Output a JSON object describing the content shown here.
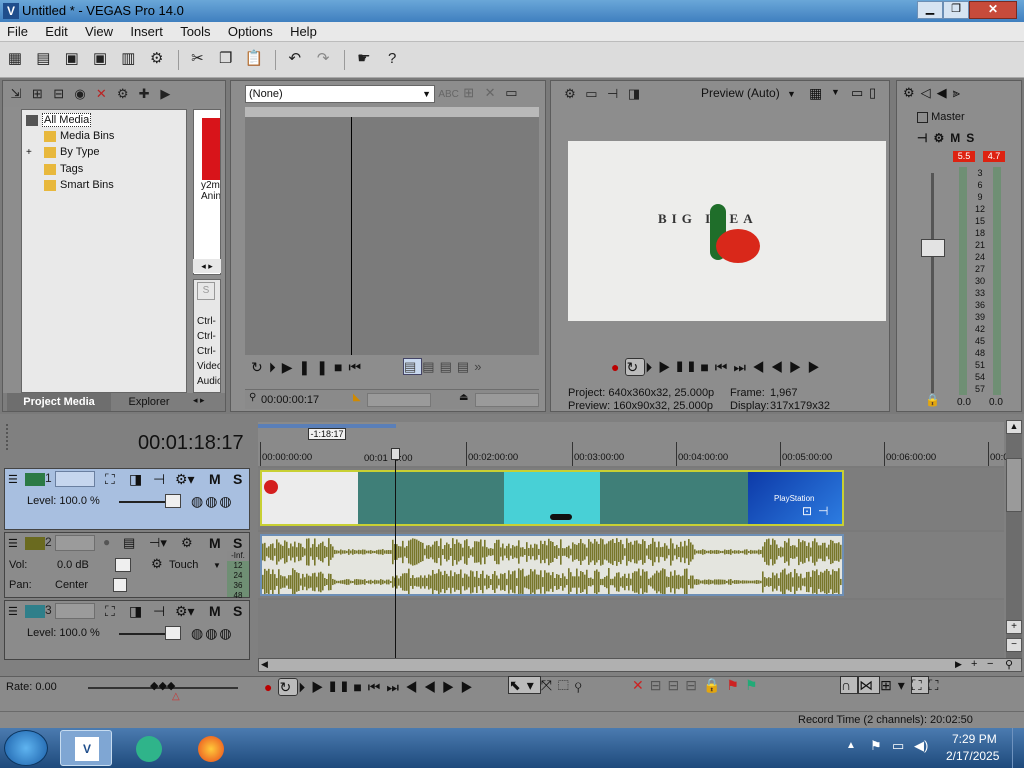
{
  "window": {
    "title": "Untitled * - VEGAS Pro 14.0",
    "app_icon": "vegas-v-icon"
  },
  "menu": [
    "File",
    "Edit",
    "View",
    "Insert",
    "Tools",
    "Options",
    "Help"
  ],
  "explorer": {
    "tree": [
      "All Media",
      "Media Bins",
      "By Type",
      "Tags",
      "Smart Bins"
    ],
    "tabs": [
      "Project Media",
      "Explorer"
    ],
    "media_caption_1": "y2m",
    "media_caption_2": "Anin",
    "side_lines": [
      "Ctrl-",
      "Ctrl-",
      "Ctrl-",
      "Video:",
      "Audio:"
    ]
  },
  "trimmer": {
    "dropdown": "(None)",
    "time": "00:00:00:17"
  },
  "preview": {
    "mode": "Preview (Auto)",
    "logo_text": "BIG IDEA",
    "project_label": "Project:",
    "project_value": "640x360x32, 25.000p",
    "preview_label": "Preview:",
    "preview_value": "160x90x32, 25.000p",
    "frame_label": "Frame:",
    "frame_value": "1,967",
    "display_label": "Display:",
    "display_value": "317x179x32"
  },
  "master": {
    "title": "Master",
    "peak_left": "5.5",
    "peak_right": "4.7",
    "scale": [
      "3",
      "6",
      "9",
      "12",
      "15",
      "18",
      "21",
      "24",
      "27",
      "30",
      "33",
      "36",
      "39",
      "42",
      "45",
      "48",
      "51",
      "54",
      "57"
    ],
    "val_left": "0.0",
    "val_right": "0.0"
  },
  "timeline": {
    "timecode": "00:01:18:17",
    "cursor_flag": "-1:18:17",
    "ruler": [
      "00:00:00:00",
      "00:01:00:00",
      "00:02:00:00",
      "00:03:00:00",
      "00:04:00:00",
      "00:05:00:00",
      "00:06:00:00",
      "00:0"
    ],
    "ruler_mid_0": "00:01",
    "ruler_mid_1": "0:00"
  },
  "tracks": [
    {
      "num": "1",
      "level_label": "Level: 100.0 %",
      "m": "M",
      "s": "S"
    },
    {
      "num": "2",
      "vol_label": "Vol:",
      "vol_value": "0.0 dB",
      "pan_label": "Pan:",
      "pan_value": "Center",
      "automation": "Touch",
      "m": "M",
      "s": "S",
      "meter_top": "-Inf.",
      "meter_scale": [
        "12",
        "24",
        "36",
        "48"
      ]
    },
    {
      "num": "3",
      "level_label": "Level: 100.0 %",
      "m": "M",
      "s": "S"
    }
  ],
  "clip_texts": {
    "playstation": "PlayStation"
  },
  "bottom": {
    "rate": "Rate: 0.00",
    "record_time": "Record Time (2 channels): 20:02:50"
  },
  "taskbar": {
    "time": "7:29 PM",
    "date": "2/17/2025"
  },
  "colors": {
    "accent_blue": "#3a6ea5",
    "clip_teal": "#3f7f78",
    "audio_olive": "#77762a",
    "selection": "#a8bfe0"
  }
}
